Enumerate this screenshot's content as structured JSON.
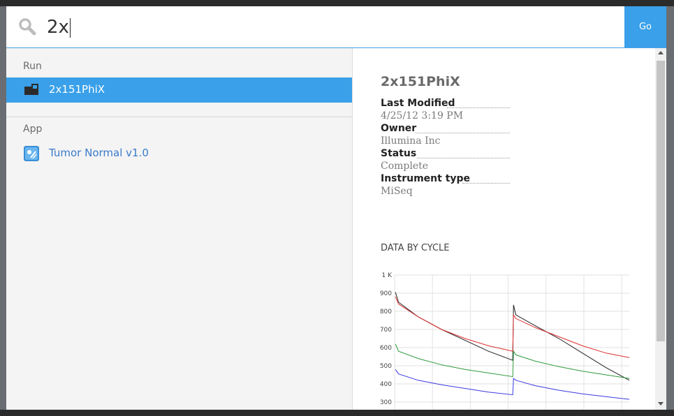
{
  "search": {
    "value": "2x",
    "go_label": "Go"
  },
  "groups": {
    "run": {
      "label": "Run",
      "items": [
        {
          "label": "2x151PhiX",
          "icon": "run-icon",
          "selected": true
        }
      ]
    },
    "app": {
      "label": "App",
      "items": [
        {
          "label": "Tumor Normal v1.0",
          "icon": "app-icon",
          "selected": false
        }
      ]
    }
  },
  "detail": {
    "title": "2x151PhiX",
    "fields": [
      {
        "key": "Last Modified",
        "value": "4/25/12 3:19 PM"
      },
      {
        "key": "Owner",
        "value": "Illumina Inc"
      },
      {
        "key": "Status",
        "value": "Complete"
      },
      {
        "key": "Instrument type",
        "value": "MiSeq"
      }
    ],
    "chart_title": "DATA BY CYCLE"
  },
  "colors": {
    "accent": "#3aa0ea",
    "link": "#3a7bc8"
  },
  "chart_data": {
    "type": "line",
    "title": "DATA BY CYCLE",
    "y_tick_labels": [
      "1 K",
      "900",
      "800",
      "700",
      "600",
      "500",
      "400",
      "300"
    ],
    "ylim": [
      300,
      1000
    ],
    "xlim": [
      0,
      300
    ],
    "grid": true,
    "series": [
      {
        "color": "#222222",
        "points": [
          [
            1,
            905
          ],
          [
            5,
            850
          ],
          [
            30,
            770
          ],
          [
            60,
            700
          ],
          [
            90,
            640
          ],
          [
            120,
            580
          ],
          [
            151,
            530
          ],
          [
            152,
            835
          ],
          [
            155,
            780
          ],
          [
            180,
            720
          ],
          [
            210,
            650
          ],
          [
            240,
            570
          ],
          [
            270,
            490
          ],
          [
            300,
            420
          ]
        ]
      },
      {
        "color": "#e03030",
        "points": [
          [
            1,
            880
          ],
          [
            5,
            840
          ],
          [
            30,
            770
          ],
          [
            60,
            700
          ],
          [
            90,
            650
          ],
          [
            120,
            610
          ],
          [
            151,
            580
          ],
          [
            152,
            780
          ],
          [
            155,
            760
          ],
          [
            180,
            710
          ],
          [
            210,
            660
          ],
          [
            240,
            610
          ],
          [
            270,
            570
          ],
          [
            300,
            545
          ]
        ]
      },
      {
        "color": "#2e9a3a",
        "points": [
          [
            1,
            620
          ],
          [
            5,
            580
          ],
          [
            30,
            540
          ],
          [
            60,
            505
          ],
          [
            90,
            480
          ],
          [
            120,
            460
          ],
          [
            151,
            440
          ],
          [
            152,
            580
          ],
          [
            155,
            560
          ],
          [
            180,
            525
          ],
          [
            210,
            495
          ],
          [
            240,
            470
          ],
          [
            270,
            450
          ],
          [
            300,
            430
          ]
        ]
      },
      {
        "color": "#3a3ae0",
        "points": [
          [
            1,
            480
          ],
          [
            5,
            455
          ],
          [
            30,
            420
          ],
          [
            60,
            395
          ],
          [
            90,
            375
          ],
          [
            120,
            355
          ],
          [
            151,
            340
          ],
          [
            152,
            430
          ],
          [
            155,
            420
          ],
          [
            180,
            390
          ],
          [
            210,
            365
          ],
          [
            240,
            345
          ],
          [
            270,
            330
          ],
          [
            300,
            315
          ]
        ]
      }
    ]
  }
}
